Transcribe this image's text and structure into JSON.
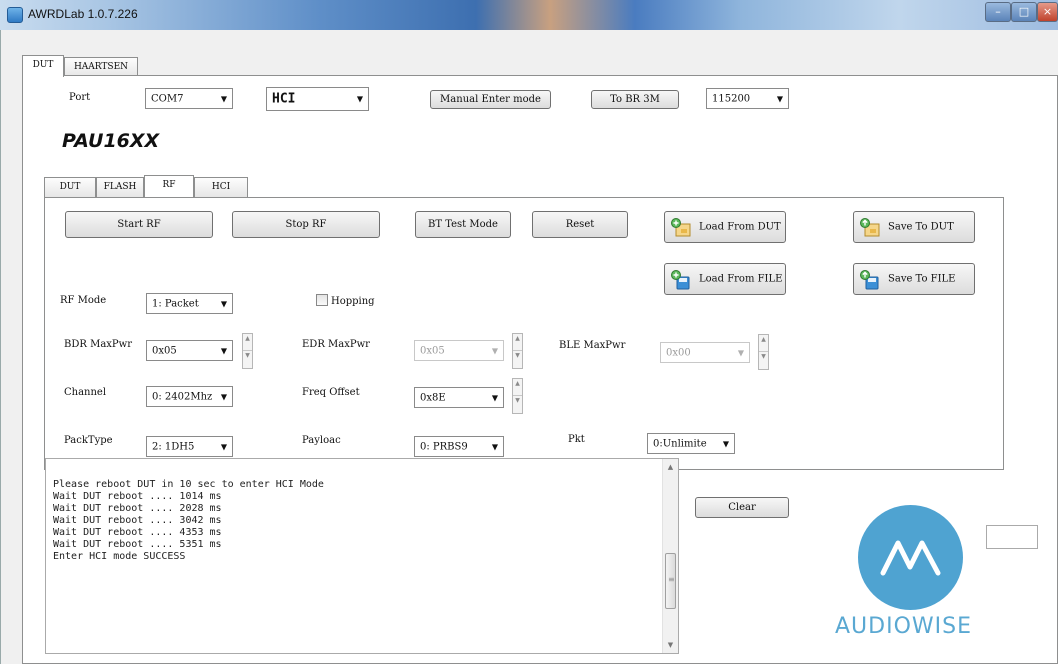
{
  "window": {
    "title": "AWRDLab 1.0.7.226",
    "min_glyph": "–",
    "max_glyph": "□",
    "close_glyph": "×"
  },
  "top_tabs": [
    "DUT",
    "HAARTSEN"
  ],
  "port": {
    "label": "Port",
    "value": "COM7"
  },
  "mode_select": "HCI",
  "manual_enter_button": "Manual Enter mode",
  "to_br_button": "To BR 3M",
  "baud": "115200",
  "device_name": "PAU16XX",
  "sub_tabs": [
    "DUT",
    "FLASH",
    "RF",
    "HCI"
  ],
  "rf": {
    "start_rf": "Start RF",
    "stop_rf": "Stop RF",
    "bt_test_mode": "BT Test Mode",
    "reset": "Reset",
    "load_from_dut": "Load From DUT",
    "save_to_dut": "Save To DUT",
    "load_from_file": "Load From FILE",
    "save_to_file": "Save To FILE",
    "rf_mode_label": "RF Mode",
    "rf_mode_value": "1: Packet",
    "hopping_label": "Hopping",
    "hopping_checked": false,
    "bdr_label": "BDR MaxPwr",
    "bdr_value": "0x05",
    "edr_label": "EDR MaxPwr",
    "edr_value": "0x05",
    "ble_label": "BLE MaxPwr",
    "ble_value": "0x00",
    "channel_label": "Channel",
    "channel_value": "0: 2402Mhz",
    "freq_label": "Freq Offset",
    "freq_value": "0x8E",
    "packtype_label": "PackType",
    "packtype_value": "2: 1DH5",
    "payload_label": "Payloac",
    "payload_value": "0: PRBS9",
    "pkt_label": "Pkt",
    "pkt_value": "0:Unlimite"
  },
  "log_lines": "Please reboot DUT in 10 sec to enter HCI Mode\nWait DUT reboot .... 1014 ms\nWait DUT reboot .... 2028 ms\nWait DUT reboot .... 3042 ms\nWait DUT reboot .... 4353 ms\nWait DUT reboot .... 5351 ms\nEnter HCI mode SUCCESS",
  "clear_button": "Clear",
  "brand": "AUDIOWISE",
  "colors": {
    "brand_blue": "#4fa3d1"
  },
  "icons": {
    "combo_arrow": "▼",
    "spin_up": "▲",
    "spin_down": "▼"
  }
}
